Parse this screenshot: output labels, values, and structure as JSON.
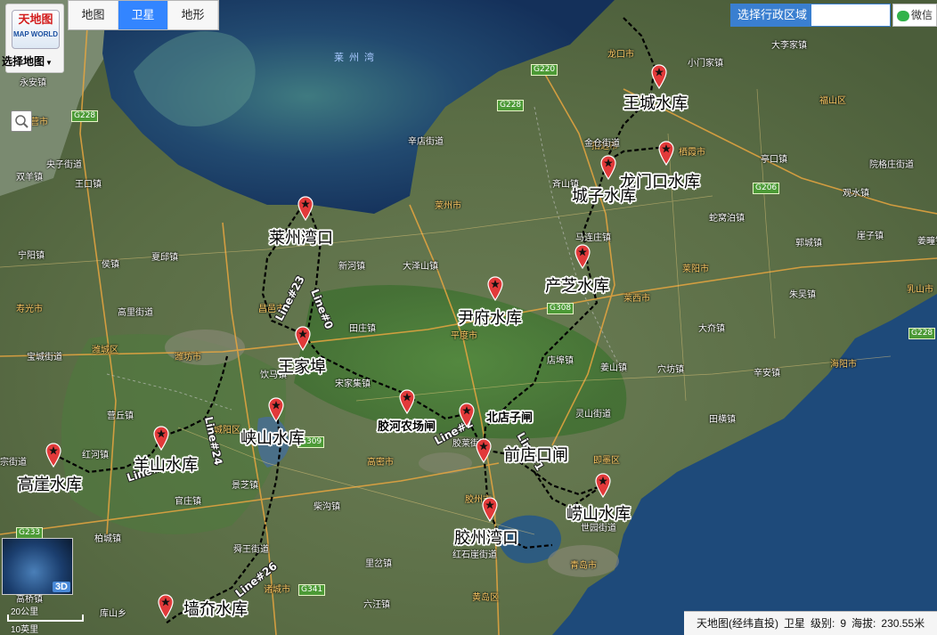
{
  "ui": {
    "logo_cn": "天地图",
    "logo_en": "MAP WORLD",
    "choose_map": "选择地图",
    "map_types": [
      "地图",
      "卫星",
      "地形"
    ],
    "active_map_type": "卫星",
    "region_select": "选择行政区域",
    "wechat": "微信",
    "overview_3d": "3D",
    "scale_top": "20公里",
    "scale_bottom": "10英里"
  },
  "status": {
    "source": "天地图(经纬直投)",
    "layer": "卫星",
    "level_label": "级别:",
    "level": "9",
    "altitude_label": "海拔:",
    "altitude": "230.55米"
  },
  "sea_labels": [
    "莱州湾"
  ],
  "roads": [
    "G228",
    "G220",
    "G228",
    "G206",
    "G308",
    "G228",
    "G309",
    "G233",
    "G341",
    "G228"
  ],
  "reservoirs": [
    "王城水库",
    "龙门口水库",
    "城子水库",
    "莱州湾口",
    "产芝水库",
    "尹府水库",
    "王家埠",
    "峡山水库",
    "胶河农场闸",
    "北店子闸",
    "前店口闸",
    "羊山水库",
    "高崖水库",
    "崂山水库",
    "胶州湾口",
    "墙夼水库"
  ],
  "line_labels": [
    "Line#23",
    "Line#0",
    "Line#24",
    "Line#",
    "Line#2",
    "Line#1",
    "Line#26"
  ],
  "cities": [
    "东营市",
    "招远市",
    "栖霞市",
    "福山区",
    "莱州市",
    "莱阳市",
    "莱西市",
    "平度市",
    "寿光市",
    "潍城区",
    "潍坊市",
    "昌邑市",
    "高密市",
    "胶州市",
    "即墨区",
    "青岛市",
    "黄岛区",
    "诸城市",
    "乳山市",
    "海阳市",
    "龙口市",
    "城阳区"
  ],
  "towns": [
    "永安镇",
    "辛店街道",
    "宁阳镇",
    "马连庄镇",
    "大泽山镇",
    "新河镇",
    "夏邱镇",
    "田庄镇",
    "店埠镇",
    "大李家镇",
    "小门家镇",
    "亭口镇",
    "院格庄街道",
    "观水镇",
    "蛇窝泊镇",
    "姜疃镇",
    "郭城镇",
    "崖子镇",
    "朱吴镇",
    "大夼镇",
    "穴坊镇",
    "辛安镇",
    "田横镇",
    "灵山街道",
    "姜山镇",
    "侯镇",
    "高里街道",
    "宝城街道",
    "营丘镇",
    "红河镇",
    "官庄镇",
    "景芝镇",
    "柴沟镇",
    "舜王街道",
    "柏城镇",
    "里岔镇",
    "六汪镇",
    "高桥镇",
    "库山乡",
    "饮马镇",
    "宋家集镇",
    "金仓街道",
    "斉山镇",
    "世园街道",
    "红石崖街道",
    "王口镇",
    "央子街道",
    "双羊镇",
    "胶莱街道",
    "宗街道"
  ]
}
